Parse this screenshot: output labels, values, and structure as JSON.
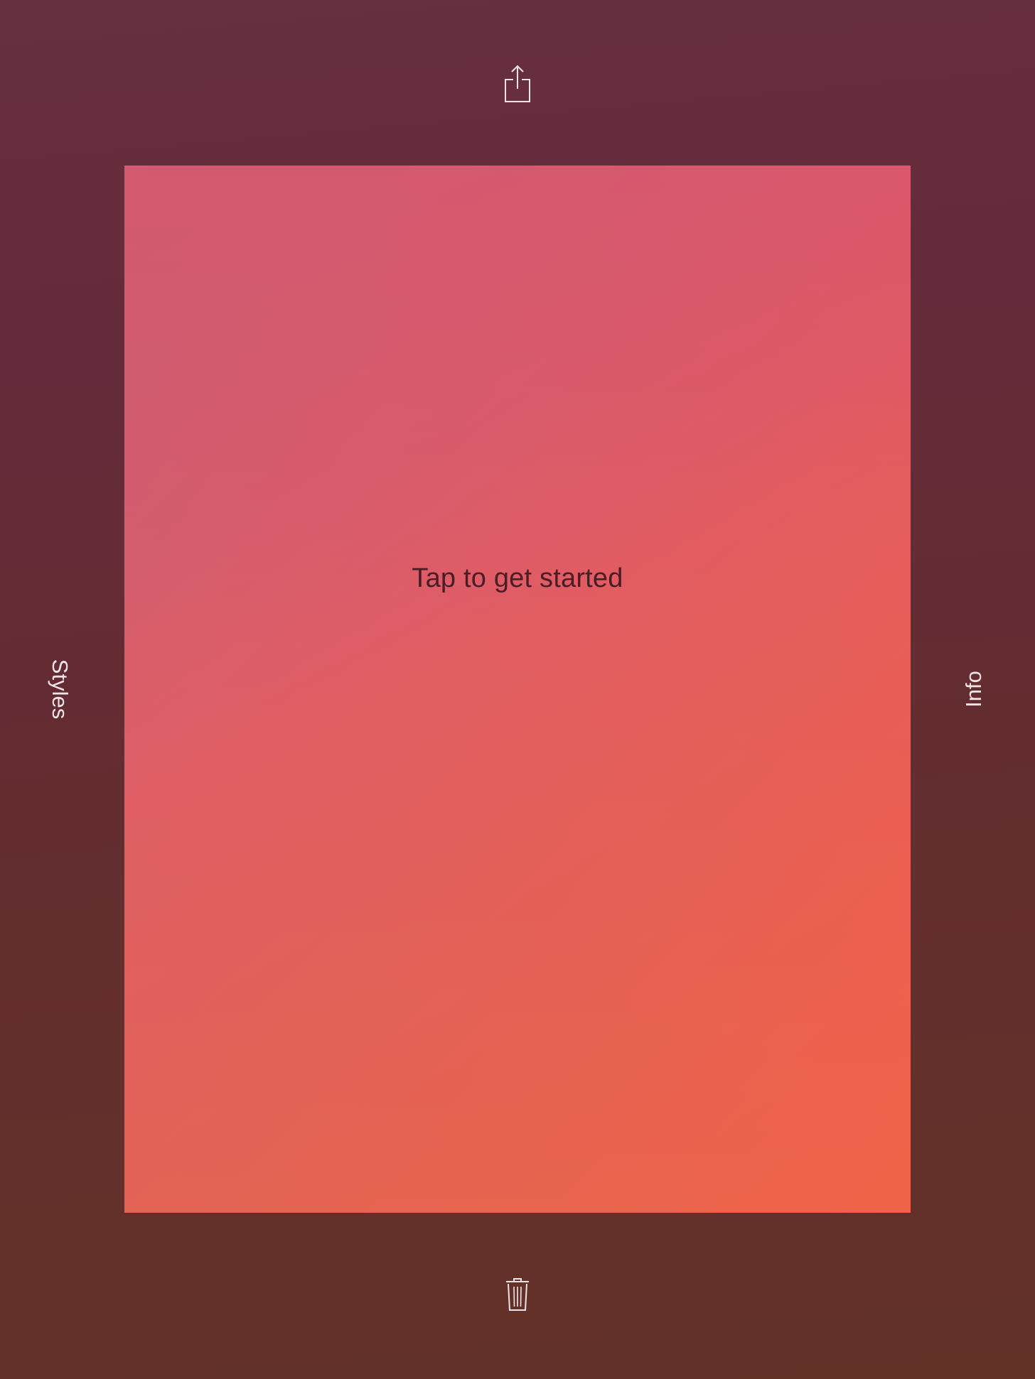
{
  "toolbar": {
    "share_icon": "share-icon",
    "delete_icon": "trash-icon"
  },
  "canvas": {
    "hint": "Tap to get started"
  },
  "side_labels": {
    "left": "Styles",
    "right": "Info"
  },
  "colors": {
    "background_top": "#673040",
    "background_bottom": "#633227",
    "canvas_top_left": "#cd5f70",
    "canvas_top_right": "#e84a6a",
    "canvas_bottom_right": "#f95c46",
    "hint_text": "#4a1c26",
    "icon_stroke": "#f2e4e6"
  }
}
